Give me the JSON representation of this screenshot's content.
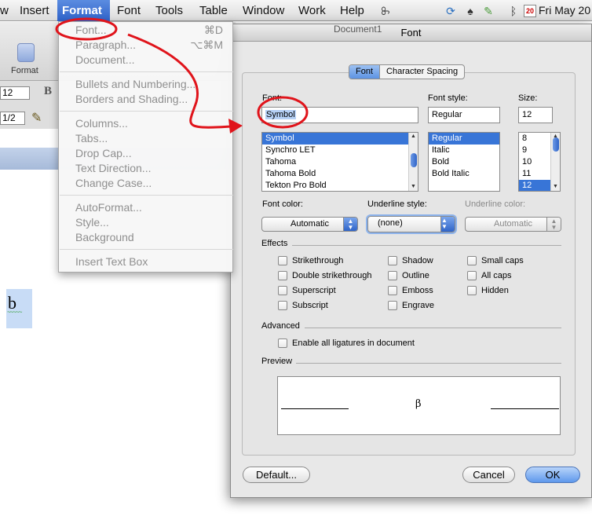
{
  "menubar": {
    "items": [
      "w",
      "Insert",
      "Format",
      "Font",
      "Tools",
      "Table",
      "Window",
      "Work",
      "Help"
    ],
    "clock": "Fri May 20",
    "calendar_day": "20"
  },
  "word": {
    "toolbar_format_label": "Format",
    "font_size": "12",
    "spacing": "1/2",
    "bold": "B",
    "doc_letter": "b",
    "squiggle": "~~~~~",
    "behind_title": "Document1"
  },
  "format_menu": {
    "font": "Font...",
    "font_shortcut": "⌘D",
    "paragraph": "Paragraph...",
    "paragraph_shortcut": "⌥⌘M",
    "document": "Document...",
    "bullets": "Bullets and Numbering...",
    "borders": "Borders and Shading...",
    "columns": "Columns...",
    "tabs": "Tabs...",
    "drop_cap": "Drop Cap...",
    "text_direction": "Text Direction...",
    "change_case": "Change Case...",
    "autoformat": "AutoFormat...",
    "style": "Style...",
    "background": "Background",
    "insert_text_box": "Insert Text Box"
  },
  "dialog": {
    "title": "Font",
    "tabs": [
      "Font",
      "Character Spacing"
    ],
    "font_label": "Font:",
    "font_value": "Symbol",
    "font_list": [
      "Symbol",
      "Synchro LET",
      "Tahoma",
      "Tahoma Bold",
      "Tekton Pro Bold"
    ],
    "style_label": "Font style:",
    "style_value": "Regular",
    "style_list": [
      "Regular",
      "Italic",
      "Bold",
      "Bold Italic"
    ],
    "size_label": "Size:",
    "size_value": "12",
    "size_list": [
      "8",
      "9",
      "10",
      "11",
      "12"
    ],
    "font_color_label": "Font color:",
    "font_color_value": "Automatic",
    "underline_style_label": "Underline style:",
    "underline_style_value": "(none)",
    "underline_color_label": "Underline color:",
    "underline_color_value": "Automatic",
    "effects_label": "Effects",
    "effects": {
      "strikethrough": "Strikethrough",
      "double_strikethrough": "Double strikethrough",
      "superscript": "Superscript",
      "subscript": "Subscript",
      "shadow": "Shadow",
      "outline": "Outline",
      "emboss": "Emboss",
      "engrave": "Engrave",
      "small_caps": "Small caps",
      "all_caps": "All caps",
      "hidden": "Hidden"
    },
    "advanced_label": "Advanced",
    "ligatures": "Enable all ligatures in document",
    "preview_label": "Preview",
    "preview_char": "β",
    "default_button": "Default...",
    "cancel_button": "Cancel",
    "ok_button": "OK"
  },
  "colors": {
    "annotation_red": "#e0141b",
    "selection_blue": "#3875d7"
  }
}
